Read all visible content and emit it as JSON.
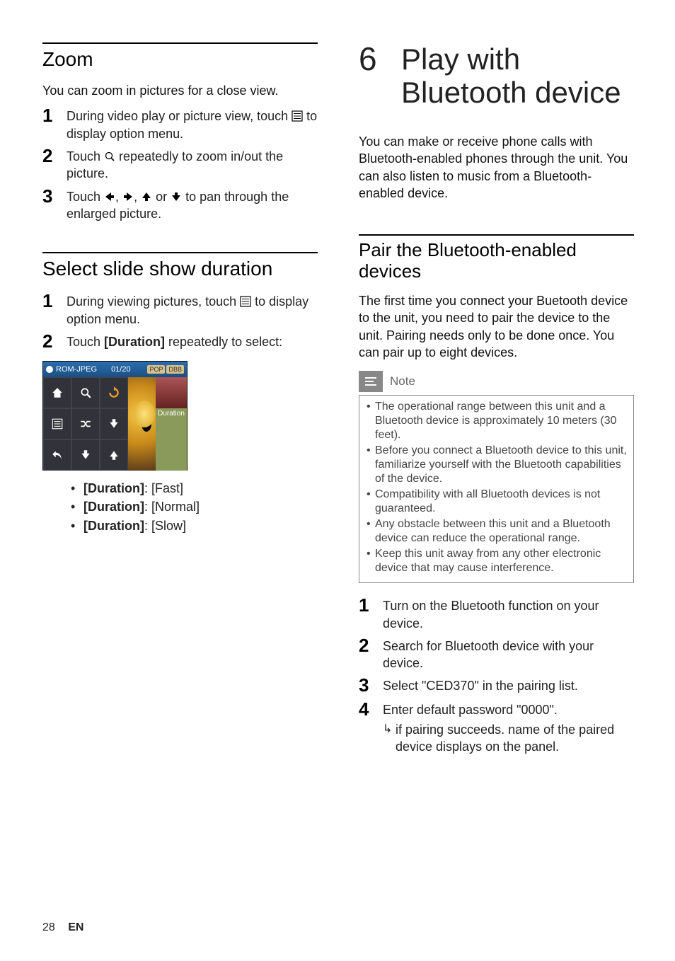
{
  "left": {
    "zoom": {
      "title": "Zoom",
      "intro": "You can zoom in pictures for a close view.",
      "steps": [
        {
          "n": "1",
          "pre": "During video play or picture view, touch ",
          "post": " to display option menu."
        },
        {
          "n": "2",
          "pre": "Touch ",
          "post": " repeatedly to zoom in/out the picture."
        },
        {
          "n": "3",
          "pre": "Touch ",
          "mid": ", ",
          "mid2": ", ",
          "mid3": " or ",
          "post": " to pan through the enlarged picture."
        }
      ]
    },
    "slide": {
      "title": "Select slide show duration",
      "steps": [
        {
          "n": "1",
          "pre": "During viewing pictures, touch ",
          "post": " to display option menu."
        },
        {
          "n": "2",
          "pre": "Touch ",
          "bold": "[Duration]",
          "post": " repeatedly to select:"
        }
      ],
      "screenshot": {
        "top_label": "ROM-JPEG",
        "counter": "01/20",
        "badge1": "POP",
        "badge2": "DBB",
        "right_label": "Duration"
      },
      "bullets": [
        {
          "b": "[Duration]",
          "rest": ": [Fast]"
        },
        {
          "b": "[Duration]",
          "rest": ": [Normal]"
        },
        {
          "b": "[Duration]",
          "rest": ": [Slow]"
        }
      ]
    }
  },
  "right": {
    "chapter_num": "6",
    "chapter_title": "Play with Bluetooth device",
    "intro": "You can make or receive phone calls with Bluetooth-enabled phones through the unit. You can also listen to music from a Bluetooth-enabled device.",
    "pair": {
      "title": "Pair the Bluetooth-enabled devices",
      "intro": "The first time you connect your Buetooth device to the unit, you need to pair the device to the unit. Pairing needs only to be done once. You can pair up to eight devices.",
      "note_label": "Note",
      "notes": [
        "The operational range between this unit and a Bluetooth device is approximately 10 meters (30 feet).",
        "Before you connect a Bluetooth device to this unit, familiarize yourself with the Bluetooth capabilities of the device.",
        "Compatibility with all Bluetooth devices is not guaranteed.",
        "Any obstacle between this unit and a Bluetooth device can reduce the operational range.",
        "Keep this unit away from any other electronic device that may cause interference."
      ],
      "steps": [
        {
          "n": "1",
          "text": "Turn on the Bluetooth function on your device."
        },
        {
          "n": "2",
          "text": "Search for Bluetooth device with your device."
        },
        {
          "n": "3",
          "text": "Select \"CED370\" in the pairing list."
        },
        {
          "n": "4",
          "text": "Enter default password \"0000\"."
        }
      ],
      "substep": "if pairing succeeds. name of the paired device displays on the panel."
    }
  },
  "footer": {
    "page": "28",
    "lang": "EN"
  }
}
